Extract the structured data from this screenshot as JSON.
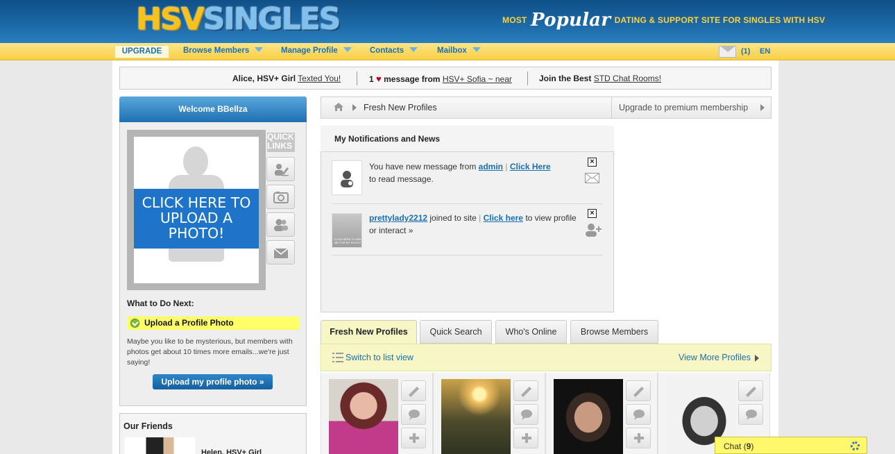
{
  "header": {
    "logo_left": "HSV",
    "logo_right": "SINGLES",
    "tagline_prefix": "MOST",
    "tagline_popular": "Popular",
    "tagline_suffix": "DATING & SUPPORT SITE FOR SINGLES WITH HSV"
  },
  "nav": {
    "upgrade": "UPGRADE",
    "items": [
      "Browse Members",
      "Manage Profile",
      "Contacts",
      "Mailbox"
    ],
    "mail_count": "(1)",
    "language": "EN"
  },
  "notice": {
    "part1_bold": "Alice, HSV+ Girl",
    "part1_link": "Texted You!",
    "part2_count": "1",
    "part2_bold": "message from",
    "part2_link": "HSV+ Sofia ~ near",
    "part3_bold": "Join the Best",
    "part3_link": "STD Chat Rooms!"
  },
  "sidebar": {
    "welcome": "Welcome BBellza",
    "upload_photo_text": "CLICK HERE TO UPLOAD A PHOTO!",
    "quick_links_title": "QUICK LINKS",
    "quick_links_icons": [
      "edit-profile-icon",
      "photo-icon",
      "users-icon",
      "mail-icon"
    ],
    "what_next_title": "What to Do Next:",
    "task": "Upload a Profile Photo",
    "task_desc": "Maybe you like to be mysterious, but members with photos get about 10 times more emails...we're just saying!",
    "upload_button": "Upload my profile photo »",
    "friends_title": "Our Friends",
    "friend_name": "Helen, HSV+ Girl"
  },
  "breadcrumb": {
    "current": "Fresh New Profiles",
    "upgrade_link": "Upgrade to premium membership"
  },
  "notifications": {
    "title": "My Notifications and News",
    "items": [
      {
        "text_before": "You have new message from",
        "link1": "admin",
        "divider": "|",
        "link2": "Click Here",
        "text_after": "to read message."
      },
      {
        "link1": "prettylady2212",
        "text_mid": "joined to site",
        "divider": "|",
        "link2": "Click here",
        "text_after": "to view profile or interact »",
        "avatar_caption": "CLICK HERE TO ASK ME FOR MY PHOTO"
      }
    ]
  },
  "tabs": {
    "items": [
      "Fresh New Profiles",
      "Quick Search",
      "Who's Online",
      "Browse Members"
    ],
    "active": "Fresh New Profiles",
    "switch_view": "Switch to list view",
    "view_more": "View More Profiles"
  },
  "chat": {
    "label": "Chat",
    "count": "9"
  },
  "colors": {
    "header_blue": "#1d6aa8",
    "nav_yellow": "#f8cf45",
    "link_blue": "#1a6fb4",
    "upload_blue": "#1e74c8",
    "highlight_yellow": "#ffff66",
    "chat_yellow": "#fff86a"
  }
}
